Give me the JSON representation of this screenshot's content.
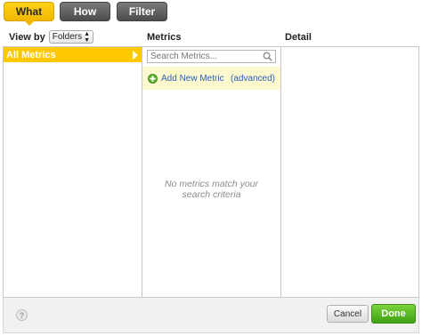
{
  "tabs": [
    {
      "label": "What",
      "active": true
    },
    {
      "label": "How",
      "active": false
    },
    {
      "label": "Filter",
      "active": false
    }
  ],
  "view_by": {
    "label": "View by",
    "selected": "Folders"
  },
  "columns": {
    "metrics": "Metrics",
    "detail": "Detail"
  },
  "folders": {
    "items": [
      {
        "label": "All Metrics",
        "selected": true
      }
    ]
  },
  "search": {
    "placeholder": "Search Metrics...",
    "value": ""
  },
  "add_metric": {
    "label": "Add New Metric",
    "advanced": "(advanced)"
  },
  "empty_message": "No metrics match your search criteria",
  "footer": {
    "help": "?",
    "cancel": "Cancel",
    "done": "Done"
  },
  "colors": {
    "accent": "#ffc800",
    "done_green": "#4fb21e",
    "link": "#2b60b8"
  }
}
